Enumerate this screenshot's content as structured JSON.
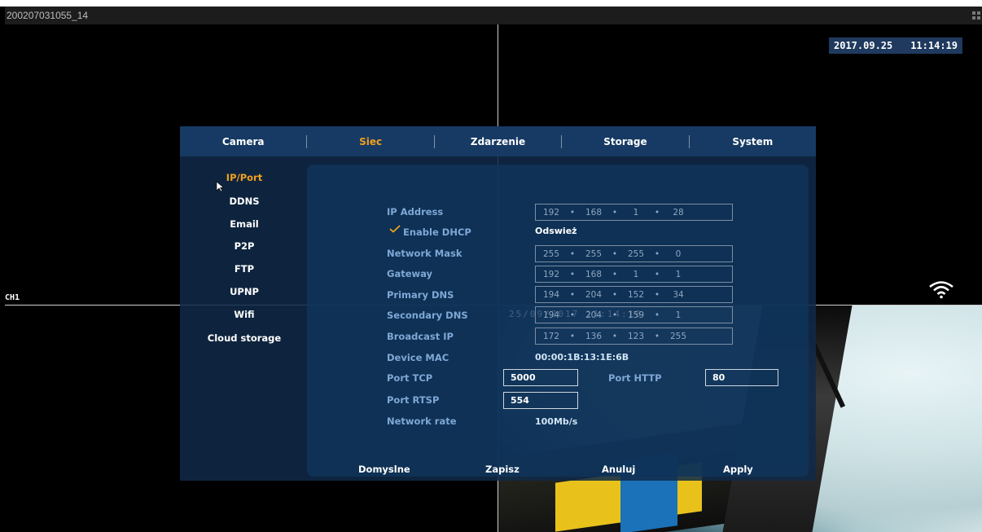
{
  "window": {
    "title": "200207031055_14"
  },
  "osd": {
    "date": "2017.09.25",
    "time": "11:14:19",
    "channel": "CH1"
  },
  "tabs": [
    {
      "label": "Camera"
    },
    {
      "label": "Siec",
      "active": true
    },
    {
      "label": "Zdarzenie"
    },
    {
      "label": "Storage"
    },
    {
      "label": "System"
    }
  ],
  "sidebar": {
    "items": [
      {
        "label": "IP/Port",
        "active": true
      },
      {
        "label": "DDNS"
      },
      {
        "label": "Email"
      },
      {
        "label": "P2P"
      },
      {
        "label": "FTP"
      },
      {
        "label": "UPNP"
      },
      {
        "label": "Wifi"
      },
      {
        "label": "Cloud storage"
      }
    ]
  },
  "network": {
    "ip_address": {
      "label": "IP Address",
      "octets": [
        "192",
        "168",
        "1",
        "28"
      ]
    },
    "dhcp": {
      "label": "Enable DHCP",
      "checked": true,
      "refresh_label": "Odswież"
    },
    "network_mask": {
      "label": "Network Mask",
      "octets": [
        "255",
        "255",
        "255",
        "0"
      ]
    },
    "gateway": {
      "label": "Gateway",
      "octets": [
        "192",
        "168",
        "1",
        "1"
      ]
    },
    "primary_dns": {
      "label": "Primary DNS",
      "octets": [
        "194",
        "204",
        "152",
        "34"
      ]
    },
    "secondary_dns": {
      "label": "Secondary DNS",
      "octets": [
        "194",
        "204",
        "159",
        "1"
      ]
    },
    "broadcast_ip": {
      "label": "Broadcast IP",
      "octets": [
        "172",
        "136",
        "123",
        "255"
      ]
    },
    "device_mac": {
      "label": "Device MAC",
      "value": "00:00:1B:13:1E:6B"
    },
    "port_tcp": {
      "label": "Port TCP",
      "value": "5000"
    },
    "port_http": {
      "label": "Port HTTP",
      "value": "80"
    },
    "port_rtsp": {
      "label": "Port RTSP",
      "value": "554"
    },
    "network_rate": {
      "label": "Network rate",
      "value": "100Mb/s"
    }
  },
  "actions": {
    "default_label": "Domyslne",
    "save_label": "Zapisz",
    "cancel_label": "Anuluj",
    "apply_label": "Apply"
  },
  "colors": {
    "accent": "#f0a020",
    "dialog_bg": "#163a63",
    "label": "#7fa8d6"
  },
  "icons": [
    "grip-icon",
    "wifi-icon",
    "cursor-icon",
    "check-icon"
  ]
}
